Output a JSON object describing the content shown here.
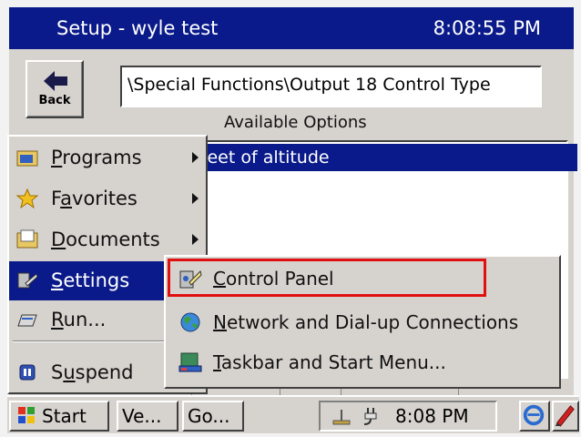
{
  "title_bar": {
    "title": "Setup - wyle test",
    "clock": "8:08:55 PM"
  },
  "toolbar": {
    "back_label": "Back"
  },
  "path": {
    "value": "\\Special Functions\\Output 18 Control Type"
  },
  "options": {
    "label": "Available Options",
    "selected_item": "ing in feet of altitude"
  },
  "start_menu": {
    "items": [
      {
        "label": "Programs",
        "accel": "P",
        "rest": "rograms",
        "icon": "programs-folder-icon"
      },
      {
        "label": "Favorites",
        "accel": "a",
        "pre": "F",
        "rest": "vorites",
        "icon": "star-icon"
      },
      {
        "label": "Documents",
        "accel": "D",
        "rest": "ocuments",
        "icon": "documents-icon"
      },
      {
        "label": "Settings",
        "accel": "S",
        "rest": "ettings",
        "icon": "settings-icon",
        "selected": true
      },
      {
        "label": "Run...",
        "accel": "R",
        "rest": "un...",
        "icon": "run-icon"
      },
      {
        "label": "Suspend",
        "accel": "u",
        "pre": "S",
        "rest": "spend",
        "icon": "suspend-icon"
      }
    ]
  },
  "settings_submenu": {
    "items": [
      {
        "label": "Control Panel",
        "accel": "C",
        "rest": "ontrol Panel",
        "icon": "control-panel-icon"
      },
      {
        "label": "Network and Dial-up Connections",
        "accel": "N",
        "rest": "etwork and Dial-up Connections",
        "icon": "network-globe-icon"
      },
      {
        "label": "Taskbar and Start Menu...",
        "accel": "T",
        "rest": "askbar and Start Menu...",
        "icon": "taskbar-icon"
      }
    ]
  },
  "taskbar": {
    "start_label": "Start",
    "task_1": "Ve...",
    "task_2": "Go...",
    "clock": "8:08 PM"
  },
  "colors": {
    "title_blue": "#0a1a8a",
    "highlight_red": "#e01010",
    "face": "#d6d3ce"
  }
}
